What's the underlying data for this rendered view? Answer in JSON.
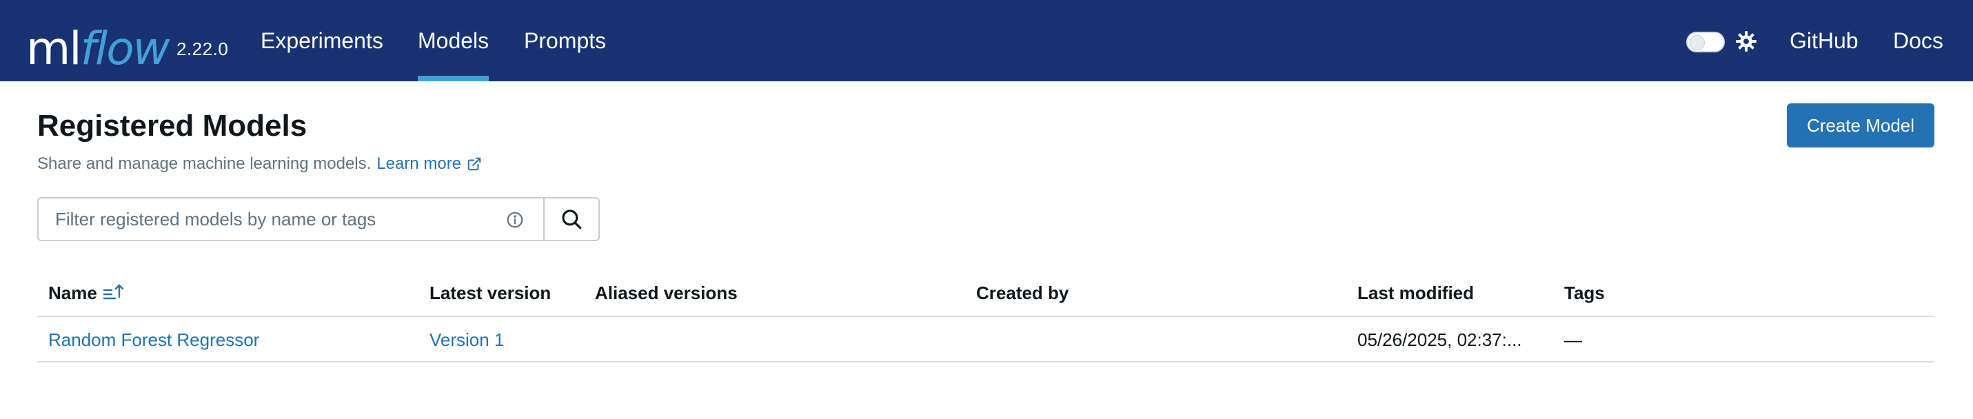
{
  "header": {
    "logo_prefix": "ml",
    "logo_suffix": "flow",
    "version": "2.22.0",
    "nav": {
      "experiments": "Experiments",
      "models": "Models",
      "prompts": "Prompts"
    },
    "active_tab": "Models",
    "github": "GitHub",
    "docs": "Docs",
    "theme_toggle_icon": "gear-icon",
    "colors": {
      "header_bg": "#193372",
      "accent": "#43a0d8"
    }
  },
  "page": {
    "title": "Registered Models",
    "subtitle": "Share and manage machine learning models.",
    "learn_more": "Learn more",
    "create_button": "Create Model",
    "colors": {
      "primary": "#2272b4"
    }
  },
  "search": {
    "placeholder": "Filter registered models by name or tags",
    "value": ""
  },
  "table": {
    "columns": {
      "name": "Name",
      "latest_version": "Latest version",
      "aliased_versions": "Aliased versions",
      "created_by": "Created by",
      "last_modified": "Last modified",
      "tags": "Tags"
    },
    "rows": [
      {
        "name": "Random Forest Regressor",
        "latest_version": "Version 1",
        "aliased_versions": "",
        "created_by": "",
        "last_modified": "05/26/2025, 02:37:...",
        "tags": "—"
      }
    ]
  }
}
